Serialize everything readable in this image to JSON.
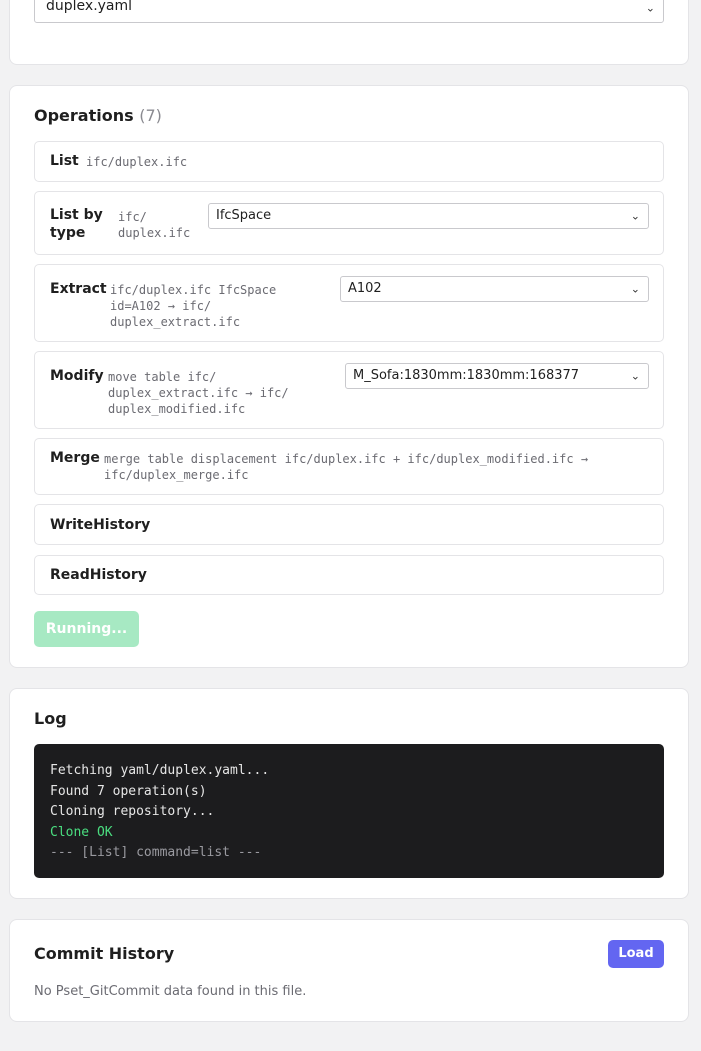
{
  "config": {
    "selected_file": "duplex.yaml"
  },
  "operations": {
    "title": "Operations",
    "count": "(7)",
    "items": [
      {
        "label": "List",
        "args": "ifc/duplex.ifc"
      },
      {
        "label": "List by\ntype",
        "args": "ifc/\nduplex.ifc",
        "select_value": "IfcSpace"
      },
      {
        "label": "Extract",
        "args": "ifc/duplex.ifc IfcSpace\nid=A102 → ifc/\nduplex_extract.ifc",
        "select_value": "A102"
      },
      {
        "label": "Modify",
        "args": "move table ifc/\nduplex_extract.ifc → ifc/\nduplex_modified.ifc",
        "select_value": "M_Sofa:1830mm:1830mm:168377"
      },
      {
        "label": "Merge",
        "args": "merge table displacement ifc/duplex.ifc + ifc/duplex_modified.ifc →\nifc/duplex_merge.ifc"
      },
      {
        "label": "WriteHistory"
      },
      {
        "label": "ReadHistory"
      }
    ],
    "run_button": "Running..."
  },
  "log": {
    "title": "Log",
    "lines": [
      {
        "text": "Fetching yaml/duplex.yaml...",
        "status": "info"
      },
      {
        "text": "Found 7 operation(s)",
        "status": "info"
      },
      {
        "text": "Cloning repository...",
        "status": "info"
      },
      {
        "text": "Clone OK",
        "status": "success"
      },
      {
        "text": "--- [List] command=list ---",
        "status": "muted"
      }
    ]
  },
  "commit_history": {
    "title": "Commit History",
    "load_button": "Load",
    "empty_message": "No Pset_GitCommit data found in this file."
  },
  "colors": {
    "accent": "#6366f1",
    "running_button": "#a7e9c3",
    "log_background": "#1c1c1e",
    "log_success": "#4ade80"
  },
  "icons": {
    "select_arrow": "chevron-down-icon"
  }
}
